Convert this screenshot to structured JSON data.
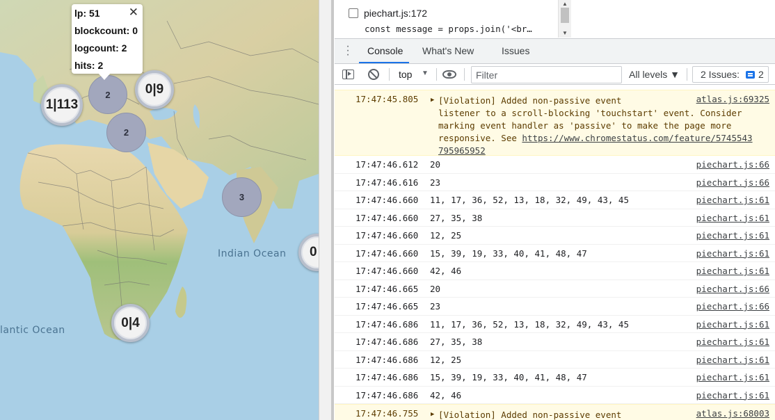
{
  "map": {
    "ocean_labels": {
      "indian": "Indian Ocean",
      "atlantic": "lantic Ocean"
    },
    "popup": {
      "lp": "lp: 51",
      "blockcount": "blockcount: 0",
      "logcount": "logcount: 2",
      "hits": "hits: 2",
      "close": "✕"
    },
    "clusters": {
      "c1": "1|113",
      "c2": "2",
      "c3": "0|9",
      "c4": "2",
      "c5": "3",
      "c6": "0",
      "c7": "0|4"
    }
  },
  "devtools": {
    "breakpoint": {
      "file": "piechart.js:172",
      "code": "const message = props.join('<br…"
    },
    "tabs": {
      "console": "Console",
      "whats_new": "What's New",
      "issues": "Issues"
    },
    "toolbar": {
      "context": "top",
      "filter_placeholder": "Filter",
      "levels": "All levels ▼",
      "issues_label": "2 Issues:",
      "issues_count": "2"
    },
    "messages": [
      {
        "type": "violation",
        "time": "17:47:45.805",
        "text": "[Violation] Added non-passive event\nlistener to a scroll-blocking 'touchstart' event. Consider\nmarking event handler as 'passive' to make the page more\nresponsive. See ",
        "link": "https://www.chromestatus.com/feature/5745543\n795965952",
        "source": "atlas.js:69325"
      },
      {
        "type": "log",
        "time": "17:47:46.612",
        "text": "20",
        "source": "piechart.js:66"
      },
      {
        "type": "log",
        "time": "17:47:46.616",
        "text": "23",
        "source": "piechart.js:66"
      },
      {
        "type": "log",
        "time": "17:47:46.660",
        "text": "11, 17, 36, 52, 13, 18, 32, 49, 43, 45",
        "source": "piechart.js:61"
      },
      {
        "type": "log",
        "time": "17:47:46.660",
        "text": "27, 35, 38",
        "source": "piechart.js:61"
      },
      {
        "type": "log",
        "time": "17:47:46.660",
        "text": "12, 25",
        "source": "piechart.js:61"
      },
      {
        "type": "log",
        "time": "17:47:46.660",
        "text": "15, 39, 19, 33, 40, 41, 48, 47",
        "source": "piechart.js:61"
      },
      {
        "type": "log",
        "time": "17:47:46.660",
        "text": "42, 46",
        "source": "piechart.js:61"
      },
      {
        "type": "log",
        "time": "17:47:46.665",
        "text": "20",
        "source": "piechart.js:66"
      },
      {
        "type": "log",
        "time": "17:47:46.665",
        "text": "23",
        "source": "piechart.js:66"
      },
      {
        "type": "log",
        "time": "17:47:46.686",
        "text": "11, 17, 36, 52, 13, 18, 32, 49, 43, 45",
        "source": "piechart.js:61"
      },
      {
        "type": "log",
        "time": "17:47:46.686",
        "text": "27, 35, 38",
        "source": "piechart.js:61"
      },
      {
        "type": "log",
        "time": "17:47:46.686",
        "text": "12, 25",
        "source": "piechart.js:61"
      },
      {
        "type": "log",
        "time": "17:47:46.686",
        "text": "15, 39, 19, 33, 40, 41, 48, 47",
        "source": "piechart.js:61"
      },
      {
        "type": "log",
        "time": "17:47:46.686",
        "text": "42, 46",
        "source": "piechart.js:61"
      },
      {
        "type": "violation",
        "time": "17:47:46.755",
        "text": "[Violation] Added non-passive event",
        "link": "",
        "source": "atlas.js:68003"
      }
    ]
  }
}
